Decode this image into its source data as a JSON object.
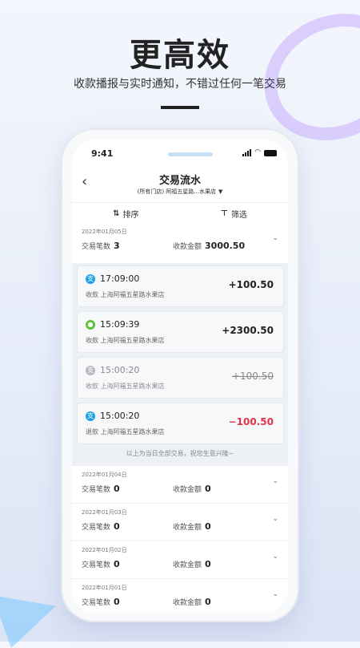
{
  "hero": {
    "title": "更高效",
    "subtitle": "收款播报与实时通知，不错过任何一笔交易"
  },
  "status_bar": {
    "time": "9:41"
  },
  "nav": {
    "back_icon": "back-chevron",
    "title": "交易流水",
    "store_selector": "(所有门店) 阿福五星路...水果店"
  },
  "toolbar": {
    "sort_label": "排序",
    "filter_label": "筛选"
  },
  "labels": {
    "count_label": "交易笔数",
    "amount_label": "收款金额"
  },
  "days": [
    {
      "date": "2022年01月05日",
      "count": "3",
      "amount": "3000.50",
      "expanded": true
    },
    {
      "date": "2022年01月04日",
      "count": "0",
      "amount": "0",
      "expanded": false
    },
    {
      "date": "2022年01月03日",
      "count": "0",
      "amount": "0",
      "expanded": false
    },
    {
      "date": "2022年01月02日",
      "count": "0",
      "amount": "0",
      "expanded": false
    },
    {
      "date": "2022年01月01日",
      "count": "0",
      "amount": "0",
      "expanded": false
    }
  ],
  "transactions": [
    {
      "time": "17:09:00",
      "type": "收款",
      "store": "上海阿福五星路水果店",
      "amount": "+100.50",
      "icon": "alipay-icon",
      "color": "#1aa0e8",
      "status": "normal"
    },
    {
      "time": "15:09:39",
      "type": "收款",
      "store": "上海阿福五星路水果店",
      "amount": "+2300.50",
      "icon": "wechat-icon",
      "color": "#5cc23a",
      "status": "normal"
    },
    {
      "time": "15:00:20",
      "type": "收款",
      "store": "上海阿福五星路水果店",
      "amount": "+100.50",
      "icon": "alipay-icon",
      "color": "#b5b8bd",
      "status": "cancelled"
    },
    {
      "time": "15:00:20",
      "type": "退款",
      "store": "上海阿福五星路水果店",
      "amount": "−100.50",
      "icon": "alipay-icon",
      "color": "#1aa0e8",
      "status": "refund"
    }
  ],
  "footnote": "以上为当日全部交易，祝您生意兴隆~"
}
